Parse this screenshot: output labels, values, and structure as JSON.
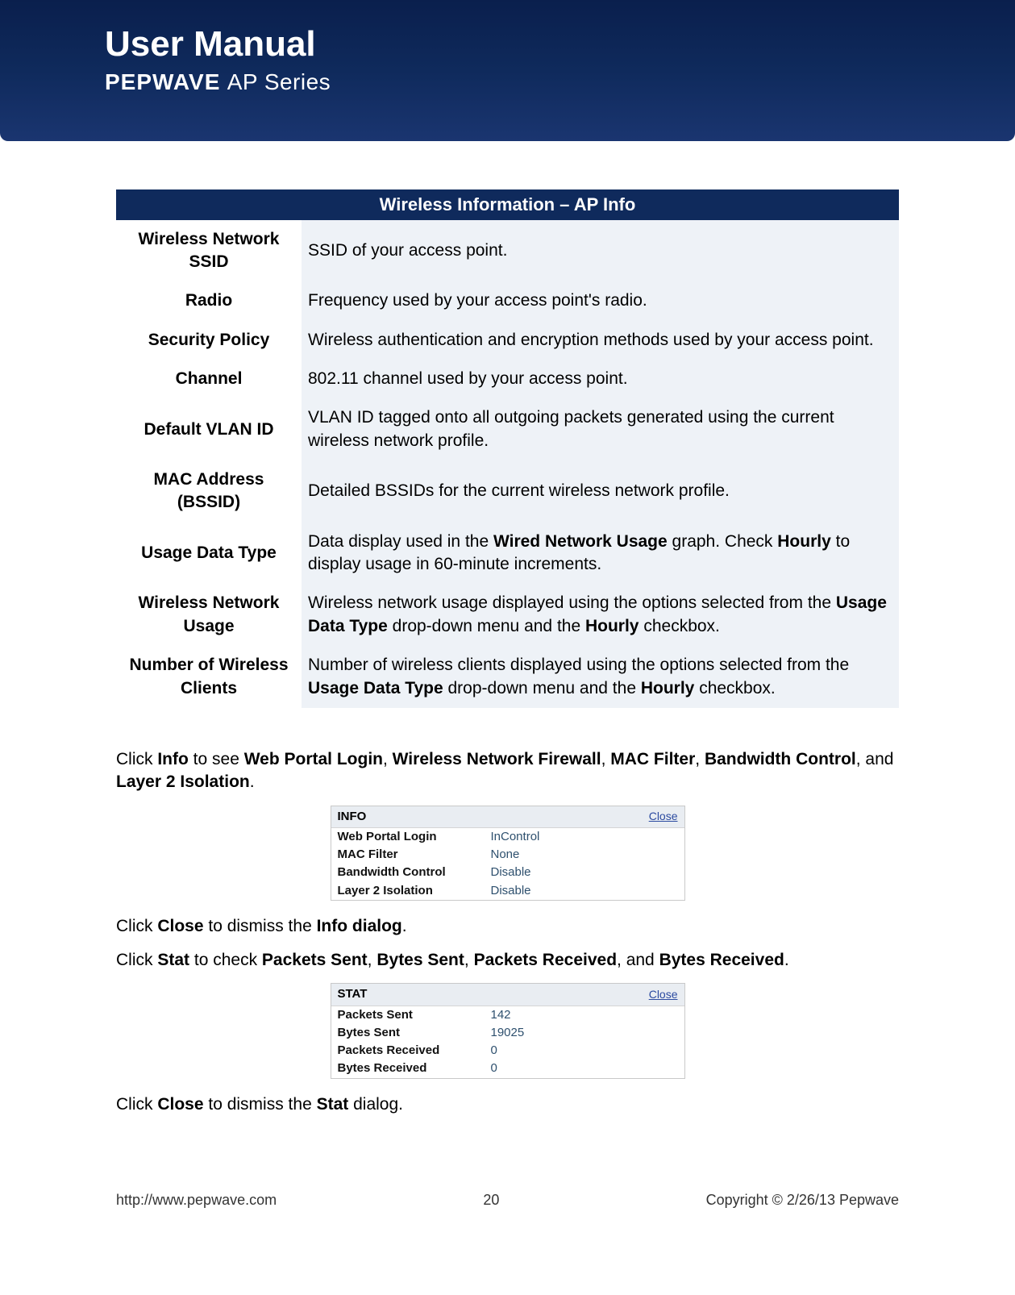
{
  "header": {
    "title": "User Manual",
    "brand": "PEPWAVE",
    "series": "AP Series"
  },
  "table": {
    "header": "Wireless Information – AP Info",
    "rows": [
      {
        "label": "Wireless Network SSID",
        "desc": "SSID of your access point."
      },
      {
        "label": "Radio",
        "desc": "Frequency used by your access point's radio."
      },
      {
        "label": "Security Policy",
        "desc": "Wireless authentication and encryption methods used by your access point."
      },
      {
        "label": "Channel",
        "desc": "802.11 channel used by your access point."
      },
      {
        "label": "Default VLAN ID",
        "desc": "VLAN ID tagged onto all outgoing packets generated using the current wireless network profile."
      },
      {
        "label": "MAC Address (BSSID)",
        "desc": "Detailed BSSIDs for the current wireless network profile."
      },
      {
        "label": "Usage Data Type",
        "desc_html": "Data display used in the <b>Wired Network Usage</b> graph. Check <b>Hourly</b> to display usage in 60-minute increments."
      },
      {
        "label": "Wireless Network Usage",
        "desc_html": "Wireless network usage displayed using the options selected from the <b>Usage Data Type</b> drop-down menu and the <b>Hourly</b> checkbox."
      },
      {
        "label": "Number of Wireless Clients",
        "desc_html": "Number of wireless clients displayed using the options selected from the <b>Usage Data Type</b> drop-down menu and the <b>Hourly</b> checkbox."
      }
    ]
  },
  "body": {
    "p1_html": "Click <b>Info</b> to see <b>Web Portal Login</b>, <b>Wireless Network Firewall</b>, <b>MAC Filter</b>, <b>Bandwidth Control</b>, and <b>Layer 2 Isolation</b>.",
    "p2_html": "Click <b>Close</b> to dismiss the <b>Info dialog</b>.",
    "p3_html": "Click <b>Stat</b> to check <b>Packets Sent</b>, <b>Bytes Sent</b>, <b>Packets Received</b>, and <b>Bytes Received</b>.",
    "p4_html": "Click <b>Close</b> to dismiss the <b>Stat</b> dialog."
  },
  "info_dialog": {
    "title": "INFO",
    "close": "Close",
    "rows": [
      {
        "k": "Web Portal Login",
        "v": "InControl"
      },
      {
        "k": "MAC Filter",
        "v": "None"
      },
      {
        "k": "Bandwidth Control",
        "v": "Disable"
      },
      {
        "k": "Layer 2 Isolation",
        "v": "Disable"
      }
    ]
  },
  "stat_dialog": {
    "title": "STAT",
    "close": "Close",
    "rows": [
      {
        "k": "Packets Sent",
        "v": "142"
      },
      {
        "k": "Bytes Sent",
        "v": "19025"
      },
      {
        "k": "Packets Received",
        "v": "0"
      },
      {
        "k": "Bytes Received",
        "v": "0"
      }
    ]
  },
  "footer": {
    "url": "http://www.pepwave.com",
    "page": "20",
    "copyright": "Copyright © 2/26/13 Pepwave"
  }
}
